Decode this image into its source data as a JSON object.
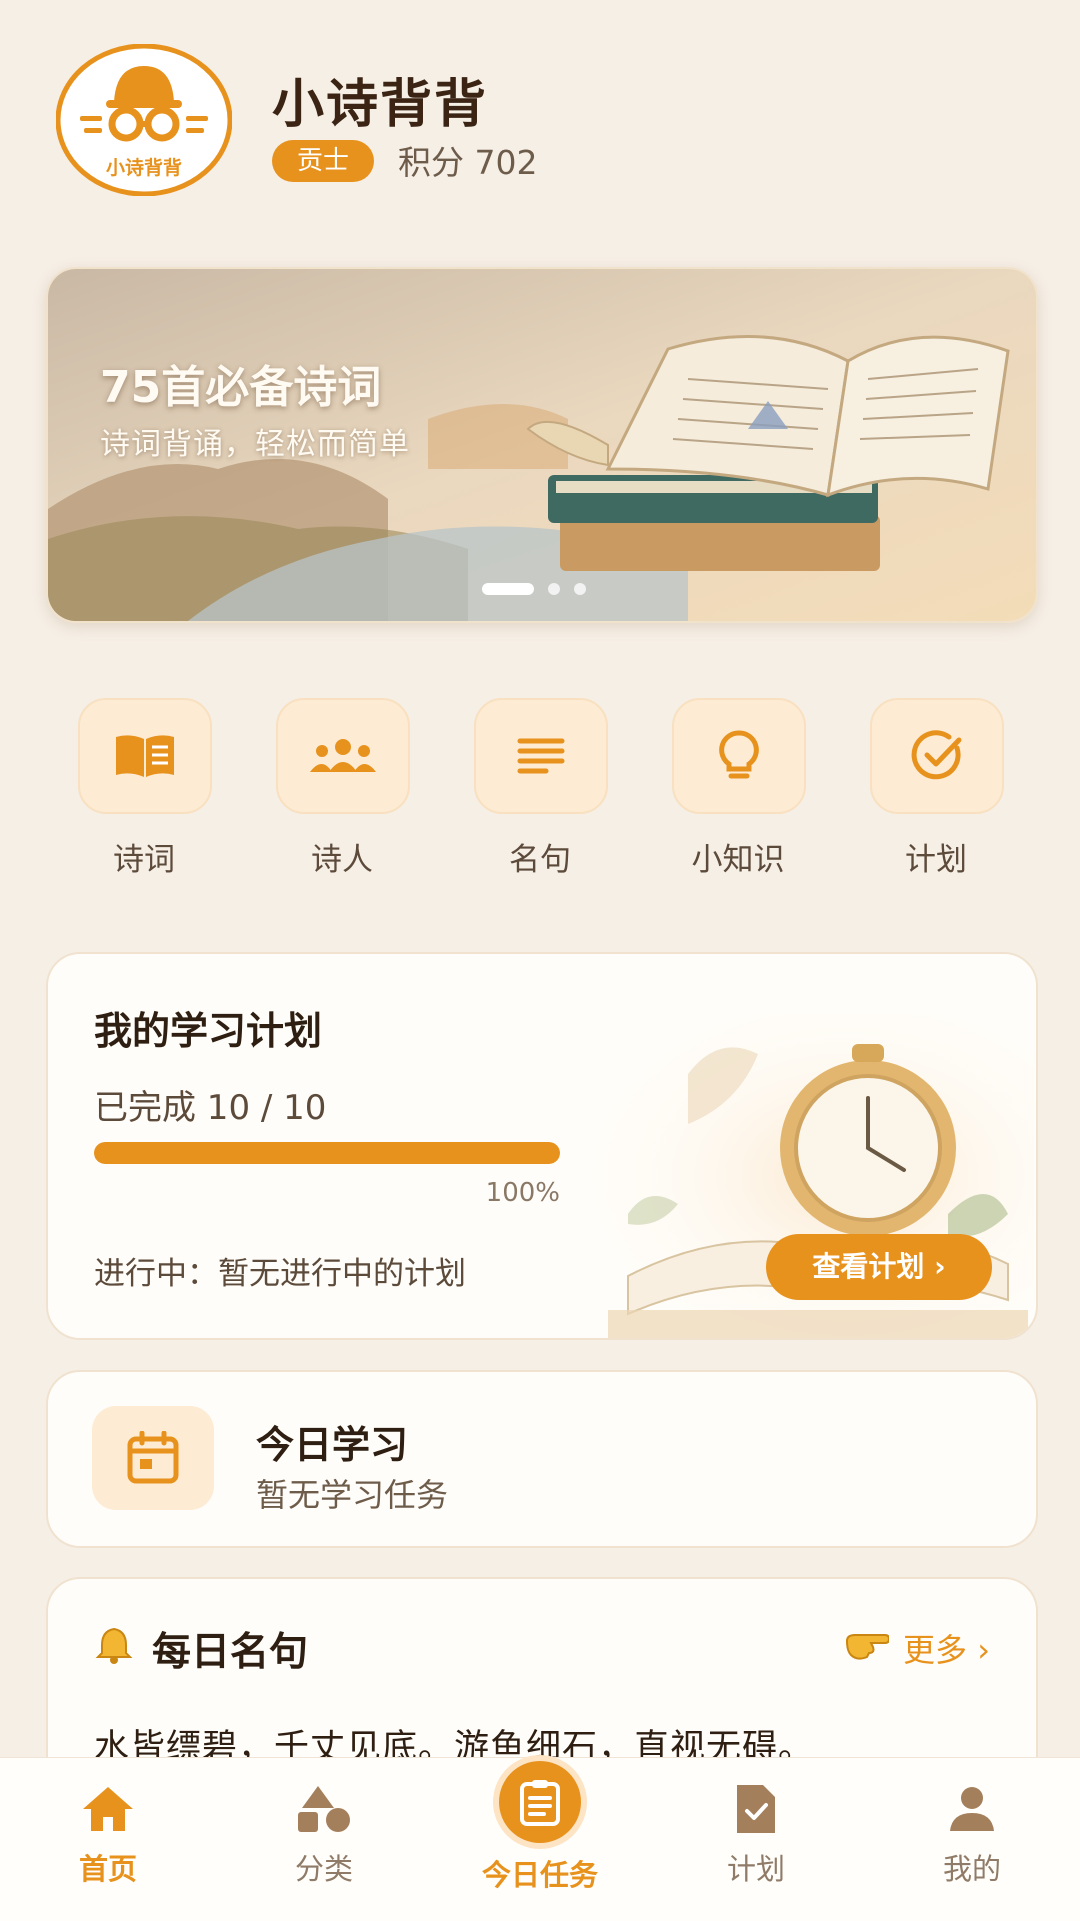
{
  "header": {
    "logo_text": "小诗背背",
    "app_title": "小诗背背",
    "rank_badge": "贡士",
    "points": "积分 702"
  },
  "banner": {
    "title": "75首必备诗词",
    "subtitle": "诗词背诵，轻松而简单",
    "slide_count": 3,
    "active_slide": 1
  },
  "categories": [
    {
      "label": "诗词",
      "icon": "book-icon"
    },
    {
      "label": "诗人",
      "icon": "people-icon"
    },
    {
      "label": "名句",
      "icon": "lines-icon"
    },
    {
      "label": "小知识",
      "icon": "lightbulb-icon"
    },
    {
      "label": "计划",
      "icon": "check-circle-icon"
    }
  ],
  "plan": {
    "title": "我的学习计划",
    "completed": "已完成 10 / 10",
    "progress": 1.0,
    "progress_label": "100%",
    "status": "进行中：暂无进行中的计划",
    "button": "查看计划 ›"
  },
  "today": {
    "title": "今日学习",
    "subtitle": "暂无学习任务"
  },
  "quote": {
    "title": "每日名句",
    "more": "更多 ›",
    "text": "水皆缥碧，千丈见底。游鱼细石，直视无碍。"
  },
  "tabbar": {
    "items": [
      {
        "label": "首页",
        "active": true
      },
      {
        "label": "分类",
        "active": false
      },
      {
        "label": "今日任务",
        "active": false
      },
      {
        "label": "计划",
        "active": false
      },
      {
        "label": "我的",
        "active": false
      }
    ]
  },
  "colors": {
    "accent": "#e8921e",
    "background": "#f6efe6",
    "icon_brown": "#a47f5c"
  }
}
